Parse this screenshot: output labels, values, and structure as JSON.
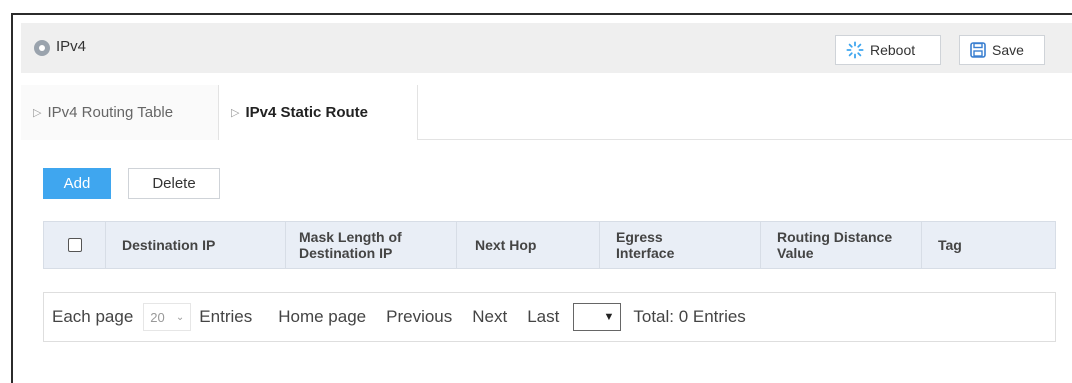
{
  "header": {
    "title": "IPv4",
    "reboot_label": "Reboot",
    "save_label": "Save",
    "reboot_icon": "reboot-icon",
    "save_icon": "floppy-save-icon"
  },
  "tabs": [
    {
      "label": "IPv4 Routing Table",
      "active": false
    },
    {
      "label": "IPv4 Static Route",
      "active": true
    }
  ],
  "toolbar": {
    "add_label": "Add",
    "delete_label": "Delete"
  },
  "table": {
    "columns": [
      {
        "key": "select",
        "label": ""
      },
      {
        "key": "dest_ip",
        "label": "Destination IP"
      },
      {
        "key": "mask_len",
        "label": "Mask Length of Destination IP"
      },
      {
        "key": "next_hop",
        "label": "Next Hop"
      },
      {
        "key": "egress",
        "label": "Egress Interface"
      },
      {
        "key": "distance",
        "label": "Routing Distance Value"
      },
      {
        "key": "tag",
        "label": "Tag"
      }
    ],
    "rows": []
  },
  "pager": {
    "each_page": "Each page",
    "page_size": "20",
    "entries": "Entries",
    "home": "Home page",
    "previous": "Previous",
    "next": "Next",
    "last": "Last",
    "total": "Total: 0 Entries"
  },
  "colors": {
    "accent": "#3fa6ef",
    "header_bg": "#efefef",
    "table_header_bg": "#e9eef6"
  }
}
